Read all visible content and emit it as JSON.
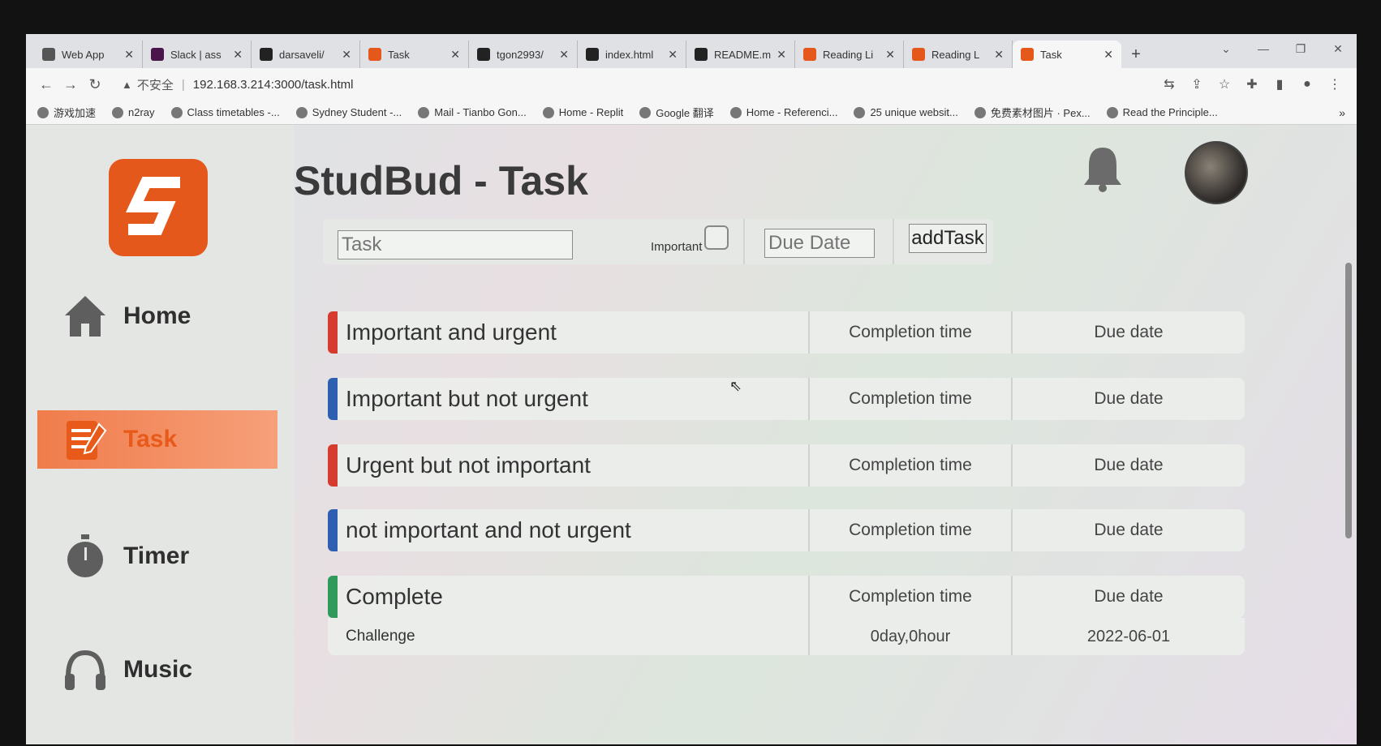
{
  "browser": {
    "tabs": [
      {
        "label": "Web App",
        "icon": "web-app-icon",
        "color": "#555555"
      },
      {
        "label": "Slack | ass",
        "icon": "slack-icon",
        "color": "#4a154b"
      },
      {
        "label": "darsaveli/",
        "icon": "github-icon",
        "color": "#222222"
      },
      {
        "label": "Task",
        "icon": "studbud-icon",
        "color": "#e4581c"
      },
      {
        "label": "tgon2993/",
        "icon": "github-icon",
        "color": "#222222"
      },
      {
        "label": "index.html",
        "icon": "replit-icon",
        "color": "#222222"
      },
      {
        "label": "README.m",
        "icon": "replit-icon",
        "color": "#222222"
      },
      {
        "label": "Reading Li",
        "icon": "studbud-icon",
        "color": "#e4581c"
      },
      {
        "label": "Reading L",
        "icon": "studbud-icon",
        "color": "#e4581c"
      },
      {
        "label": "Task",
        "icon": "studbud-icon",
        "color": "#e4581c"
      }
    ],
    "address": {
      "insecure_label": "不安全",
      "url": "192.168.3.214:3000/task.html"
    },
    "bookmarks": [
      "游戏加速",
      "n2ray",
      "Class timetables -...",
      "Sydney Student -...",
      "Mail - Tianbo Gon...",
      "Home - Replit",
      "Google 翻译",
      "Home - Referenci...",
      "25 unique websit...",
      "免费素材图片 · Pex...",
      "Read the Principle..."
    ],
    "bookmarks_more": "»"
  },
  "sidebar": {
    "items": [
      {
        "label": "Home"
      },
      {
        "label": "Task"
      },
      {
        "label": "Timer"
      },
      {
        "label": "Music"
      }
    ]
  },
  "main": {
    "title": "StudBud - Task",
    "form": {
      "task_placeholder": "Task",
      "important_label": "Important",
      "due_placeholder": "Due Date",
      "add_label": "addTask"
    },
    "sections": [
      {
        "title": "Important and urgent",
        "col1": "Completion time",
        "col2": "Due date",
        "color": "#d63b2f"
      },
      {
        "title": "Important but not urgent",
        "col1": "Completion time",
        "col2": "Due date",
        "color": "#2f5fb0"
      },
      {
        "title": "Urgent but not important",
        "col1": "Completion time",
        "col2": "Due date",
        "color": "#d63b2f"
      },
      {
        "title": "not important and not urgent",
        "col1": "Completion time",
        "col2": "Due date",
        "color": "#2f5fb0"
      },
      {
        "title": "Complete",
        "col1": "Completion time",
        "col2": "Due date",
        "color": "#2f9a5a"
      }
    ],
    "complete_rows": [
      {
        "name": "Challenge",
        "completion": "0day,0hour",
        "due": "2022-06-01"
      }
    ]
  }
}
